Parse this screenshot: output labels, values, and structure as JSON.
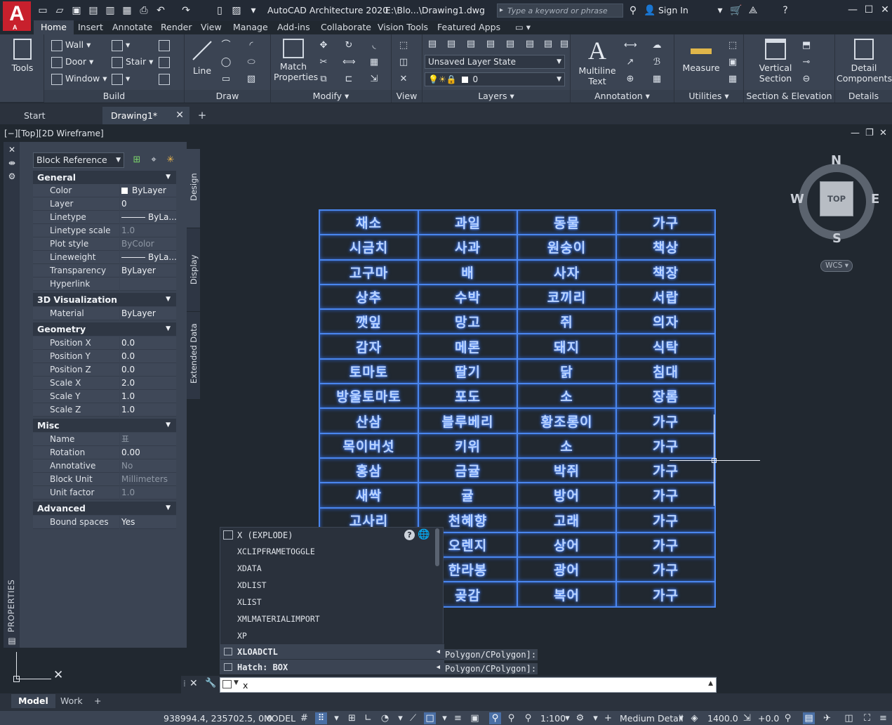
{
  "app": {
    "logo_letter": "A",
    "logo_sub": "A",
    "title": "AutoCAD Architecture 2020",
    "doc_path": "E:\\Blo...\\Drawing1.dwg",
    "search_placeholder": "Type a keyword or phrase",
    "sign_in": "Sign In"
  },
  "ribbon_tabs": [
    "Home",
    "Insert",
    "Annotate",
    "Render",
    "View",
    "Manage",
    "Add-ins",
    "Collaborate",
    "Vision Tools",
    "Featured Apps"
  ],
  "ribbon": {
    "tools_label": "Tools",
    "build": {
      "title": "Build",
      "wall": "Wall",
      "door": "Door",
      "window": "Window",
      "stair": "Stair"
    },
    "draw": {
      "title": "Draw",
      "line": "Line"
    },
    "modify": {
      "title": "Modify",
      "match": "Match",
      "properties": "Properties"
    },
    "view": {
      "title": "View"
    },
    "layers": {
      "title": "Layers",
      "state": "Unsaved Layer State",
      "current_layer": "0"
    },
    "annotation": {
      "title": "Annotation",
      "multiline": "Multiline",
      "text": "Text"
    },
    "utilities": {
      "title": "Utilities",
      "measure": "Measure"
    },
    "section": {
      "title": "Section & Elevation",
      "vertical": "Vertical",
      "section_label": "Section"
    },
    "details": {
      "title": "Details",
      "detail": "Detail",
      "components": "Components"
    }
  },
  "file_tabs": {
    "start": "Start",
    "drawing": "Drawing1*"
  },
  "viewport": {
    "label": "[−][Top][2D Wireframe]"
  },
  "properties": {
    "palette_label": "PROPERTIES",
    "object_type": "Block Reference",
    "tabs": [
      "Design",
      "Display",
      "Extended Data"
    ],
    "sections": {
      "general": "General",
      "visualization": "3D Visualization",
      "geometry": "Geometry",
      "misc": "Misc",
      "advanced": "Advanced"
    },
    "general": [
      {
        "key": "Color",
        "value": "ByLayer"
      },
      {
        "key": "Layer",
        "value": "0"
      },
      {
        "key": "Linetype",
        "value": "ByLa..."
      },
      {
        "key": "Linetype scale",
        "value": "1.0"
      },
      {
        "key": "Plot style",
        "value": "ByColor"
      },
      {
        "key": "Lineweight",
        "value": "ByLa..."
      },
      {
        "key": "Transparency",
        "value": "ByLayer"
      },
      {
        "key": "Hyperlink",
        "value": ""
      }
    ],
    "visualization": [
      {
        "key": "Material",
        "value": "ByLayer"
      }
    ],
    "geometry": [
      {
        "key": "Position X",
        "value": "0.0"
      },
      {
        "key": "Position Y",
        "value": "0.0"
      },
      {
        "key": "Position Z",
        "value": "0.0"
      },
      {
        "key": "Scale X",
        "value": "2.0"
      },
      {
        "key": "Scale Y",
        "value": "1.0"
      },
      {
        "key": "Scale Z",
        "value": "1.0"
      }
    ],
    "misc": [
      {
        "key": "Name",
        "value": "표"
      },
      {
        "key": "Rotation",
        "value": "0.00"
      },
      {
        "key": "Annotative",
        "value": "No"
      },
      {
        "key": "Block Unit",
        "value": "Millimeters"
      },
      {
        "key": "Unit factor",
        "value": "1.0"
      }
    ],
    "advanced": [
      {
        "key": "Bound spaces",
        "value": "Yes"
      }
    ]
  },
  "table_rows": [
    [
      "채소",
      "과일",
      "동물",
      "가구"
    ],
    [
      "시금치",
      "사과",
      "원숭이",
      "책상"
    ],
    [
      "고구마",
      "배",
      "사자",
      "책장"
    ],
    [
      "상추",
      "수박",
      "코끼리",
      "서랍"
    ],
    [
      "깻잎",
      "망고",
      "쥐",
      "의자"
    ],
    [
      "감자",
      "메론",
      "돼지",
      "식탁"
    ],
    [
      "토마토",
      "딸기",
      "닭",
      "침대"
    ],
    [
      "방울토마토",
      "포도",
      "소",
      "장롬"
    ],
    [
      "산삼",
      "블루베리",
      "황조롱이",
      "가구"
    ],
    [
      "목이버섯",
      "키위",
      "소",
      "가구"
    ],
    [
      "홍삼",
      "금귤",
      "박쥐",
      "가구"
    ],
    [
      "새싹",
      "귤",
      "방어",
      "가구"
    ],
    [
      "고사리",
      "천혜향",
      "고래",
      "가구"
    ],
    [
      "",
      "오렌지",
      "상어",
      "가구"
    ],
    [
      "",
      "한라봉",
      "광어",
      "가구"
    ],
    [
      "",
      "곶감",
      "복어",
      "가구"
    ]
  ],
  "viewcube": {
    "n": "N",
    "s": "S",
    "e": "E",
    "w": "W",
    "face": "TOP",
    "wcs": "WCS"
  },
  "autocomplete": {
    "header": "X (EXPLODE)",
    "items": [
      "XCLIPFRAMETOGGLE",
      "XDATA",
      "XDLIST",
      "XLIST",
      "XMLMATERIALIMPORT",
      "XP"
    ],
    "sub1": "XLOADCTL",
    "sub2": "Hatch: BOX"
  },
  "command_history": [
    "Polygon/CPolygon]:",
    "Polygon/CPolygon]:"
  ],
  "command_input": "x",
  "layout_tabs": [
    "Model",
    "Work"
  ],
  "status": {
    "coords": "938994.4, 235702.5, 0.0",
    "space": "MODEL",
    "scale": "1:100",
    "detail": "Medium Detail",
    "elevation": "1400.0",
    "offset": "+0.0"
  }
}
